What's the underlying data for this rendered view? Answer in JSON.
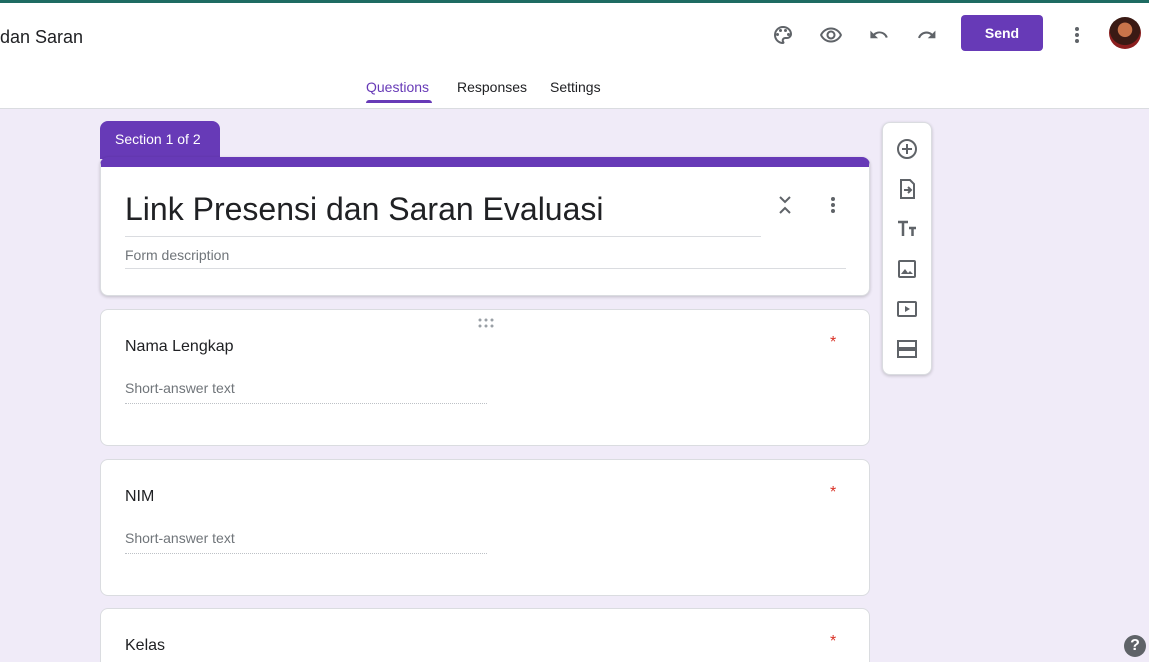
{
  "header": {
    "doc_title": "dan Saran",
    "send_label": "Send",
    "icons": [
      "palette-icon",
      "eye-icon",
      "undo-icon",
      "redo-icon",
      "more-vert-icon"
    ]
  },
  "tabs": {
    "questions": "Questions",
    "responses": "Responses",
    "settings": "Settings",
    "active": "Questions"
  },
  "section": {
    "label": "Section 1 of 2"
  },
  "form": {
    "title": "Link Presensi dan Saran Evaluasi",
    "description_placeholder": "Form description"
  },
  "questions": [
    {
      "label": "Nama Lengkap",
      "required_mark": "*",
      "answer_placeholder": "Short-answer text"
    },
    {
      "label": "NIM",
      "required_mark": "*",
      "answer_placeholder": "Short-answer text"
    },
    {
      "label": "Kelas",
      "required_mark": "*"
    }
  ],
  "toolbar": {
    "icons": [
      "add-question-icon",
      "import-questions-icon",
      "add-title-icon",
      "add-image-icon",
      "add-video-icon",
      "add-section-icon"
    ]
  },
  "help": {
    "label": "?"
  },
  "colors": {
    "accent": "#673ab7",
    "background": "#f0ebf8",
    "required": "#d93025"
  }
}
